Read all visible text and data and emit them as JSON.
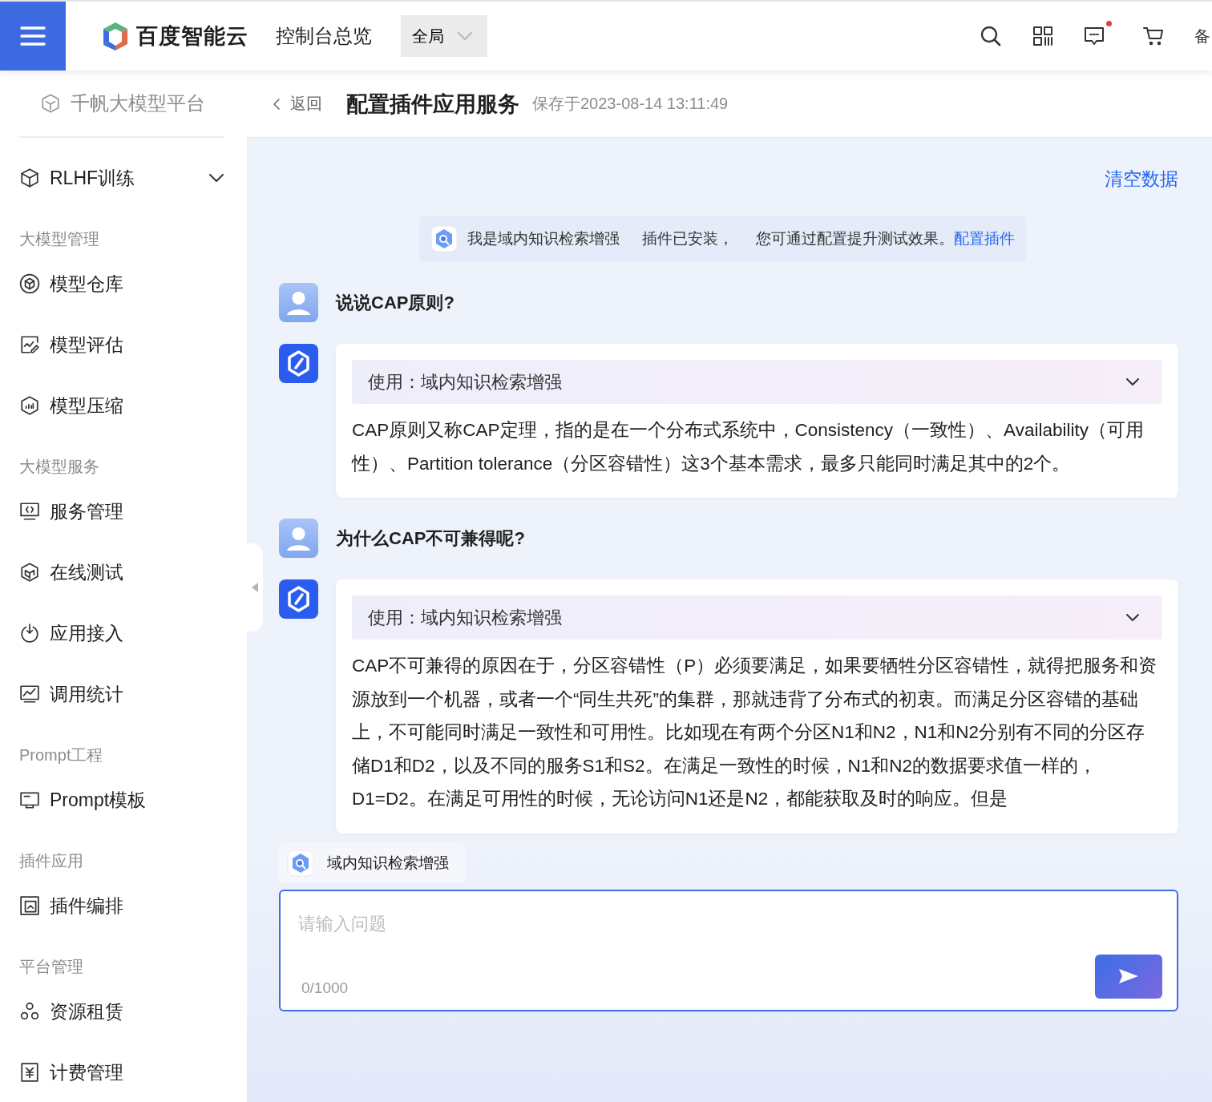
{
  "topbar": {
    "brand": "百度智能云",
    "console": "控制台总览",
    "scope": "全局",
    "message_unread": true,
    "cut_label": "备"
  },
  "sidebar": {
    "platform": "千帆大模型平台",
    "groups": [
      {
        "items": [
          {
            "label": "RLHF训练",
            "expanded": false
          }
        ]
      },
      {
        "title": "大模型管理",
        "items": [
          {
            "label": "模型仓库"
          },
          {
            "label": "模型评估"
          },
          {
            "label": "模型压缩"
          }
        ]
      },
      {
        "title": "大模型服务",
        "items": [
          {
            "label": "服务管理"
          },
          {
            "label": "在线测试"
          },
          {
            "label": "应用接入"
          },
          {
            "label": "调用统计"
          }
        ]
      },
      {
        "title": "Prompt工程",
        "items": [
          {
            "label": "Prompt模板"
          }
        ]
      },
      {
        "title": "插件应用",
        "items": [
          {
            "label": "插件编排"
          }
        ]
      },
      {
        "title": "平台管理",
        "items": [
          {
            "label": "资源租赁"
          },
          {
            "label": "计费管理"
          }
        ]
      }
    ]
  },
  "page_header": {
    "back": "返回",
    "title": "配置插件应用服务",
    "saved": "保存于2023-08-14 13:11:49"
  },
  "chat": {
    "clear": "清空数据",
    "notice": {
      "plugin": "我是域内知识检索增强",
      "status": "插件已安装，",
      "hint": "您可通过配置提升测试效果。",
      "link": "配置插件"
    },
    "messages": [
      {
        "kind": "user",
        "text": "说说CAP原则?"
      },
      {
        "kind": "bot",
        "plugin_label": "使用：域内知识检索增强",
        "expanded": false,
        "text": "CAP原则又称CAP定理，指的是在一个分布式系统中，Consistency（一致性）、Availability（可用性）、Partition tolerance（分区容错性）这3个基本需求，最多只能同时满足其中的2个。"
      },
      {
        "kind": "user",
        "text": "为什么CAP不可兼得呢?"
      },
      {
        "kind": "bot",
        "plugin_label": "使用：域内知识检索增强",
        "expanded": false,
        "text": "CAP不可兼得的原因在于，分区容错性（P）必须要满足，如果要牺牲分区容错性，就得把服务和资源放到一个机器，或者一个“同生共死”的集群，那就违背了分布式的初衷。而满足分区容错的基础上，不可能同时满足一致性和可用性。比如现在有两个分区N1和N2，N1和N2分别有不同的分区存储D1和D2，以及不同的服务S1和S2。在满足一致性的时候，N1和N2的数据要求值一样的，D1=D2。在满足可用性的时候，无论访问N1还是N2，都能获取及时的响应。但是"
      }
    ],
    "plugin_chip": "域内知识检索增强",
    "input": {
      "placeholder": "请输入问题",
      "counter": "0/1000"
    }
  }
}
